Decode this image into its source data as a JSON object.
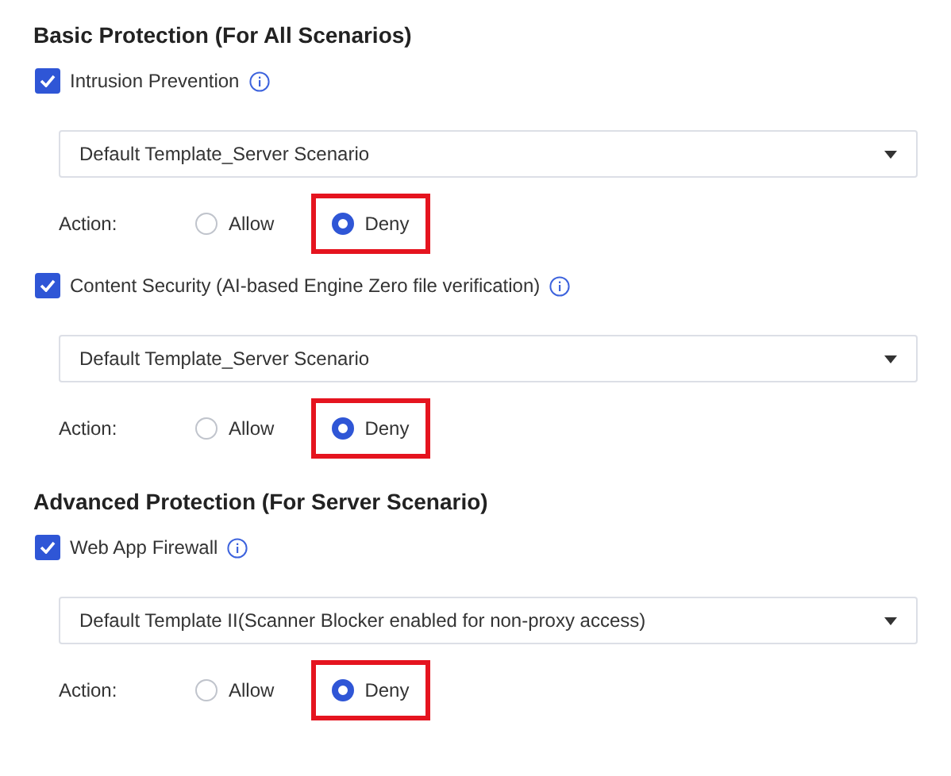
{
  "sections": [
    {
      "title": "Basic Protection (For All Scenarios)",
      "items": [
        {
          "label": "Intrusion Prevention",
          "checked": true,
          "select": {
            "value": "Default Template_Server Scenario"
          },
          "action": {
            "label": "Action:",
            "options": [
              {
                "label": "Allow",
                "selected": false,
                "highlighted": false
              },
              {
                "label": "Deny",
                "selected": true,
                "highlighted": true
              }
            ]
          }
        },
        {
          "label": "Content Security (AI-based Engine Zero file verification)",
          "checked": true,
          "select": {
            "value": "Default Template_Server Scenario"
          },
          "action": {
            "label": "Action:",
            "options": [
              {
                "label": "Allow",
                "selected": false,
                "highlighted": false
              },
              {
                "label": "Deny",
                "selected": true,
                "highlighted": true
              }
            ]
          }
        }
      ]
    },
    {
      "title": "Advanced Protection (For Server Scenario)",
      "items": [
        {
          "label": "Web App Firewall",
          "checked": true,
          "select": {
            "value": "Default Template II(Scanner Blocker enabled for non-proxy access)"
          },
          "action": {
            "label": "Action:",
            "options": [
              {
                "label": "Allow",
                "selected": false,
                "highlighted": false
              },
              {
                "label": "Deny",
                "selected": true,
                "highlighted": true
              }
            ]
          }
        }
      ]
    }
  ]
}
